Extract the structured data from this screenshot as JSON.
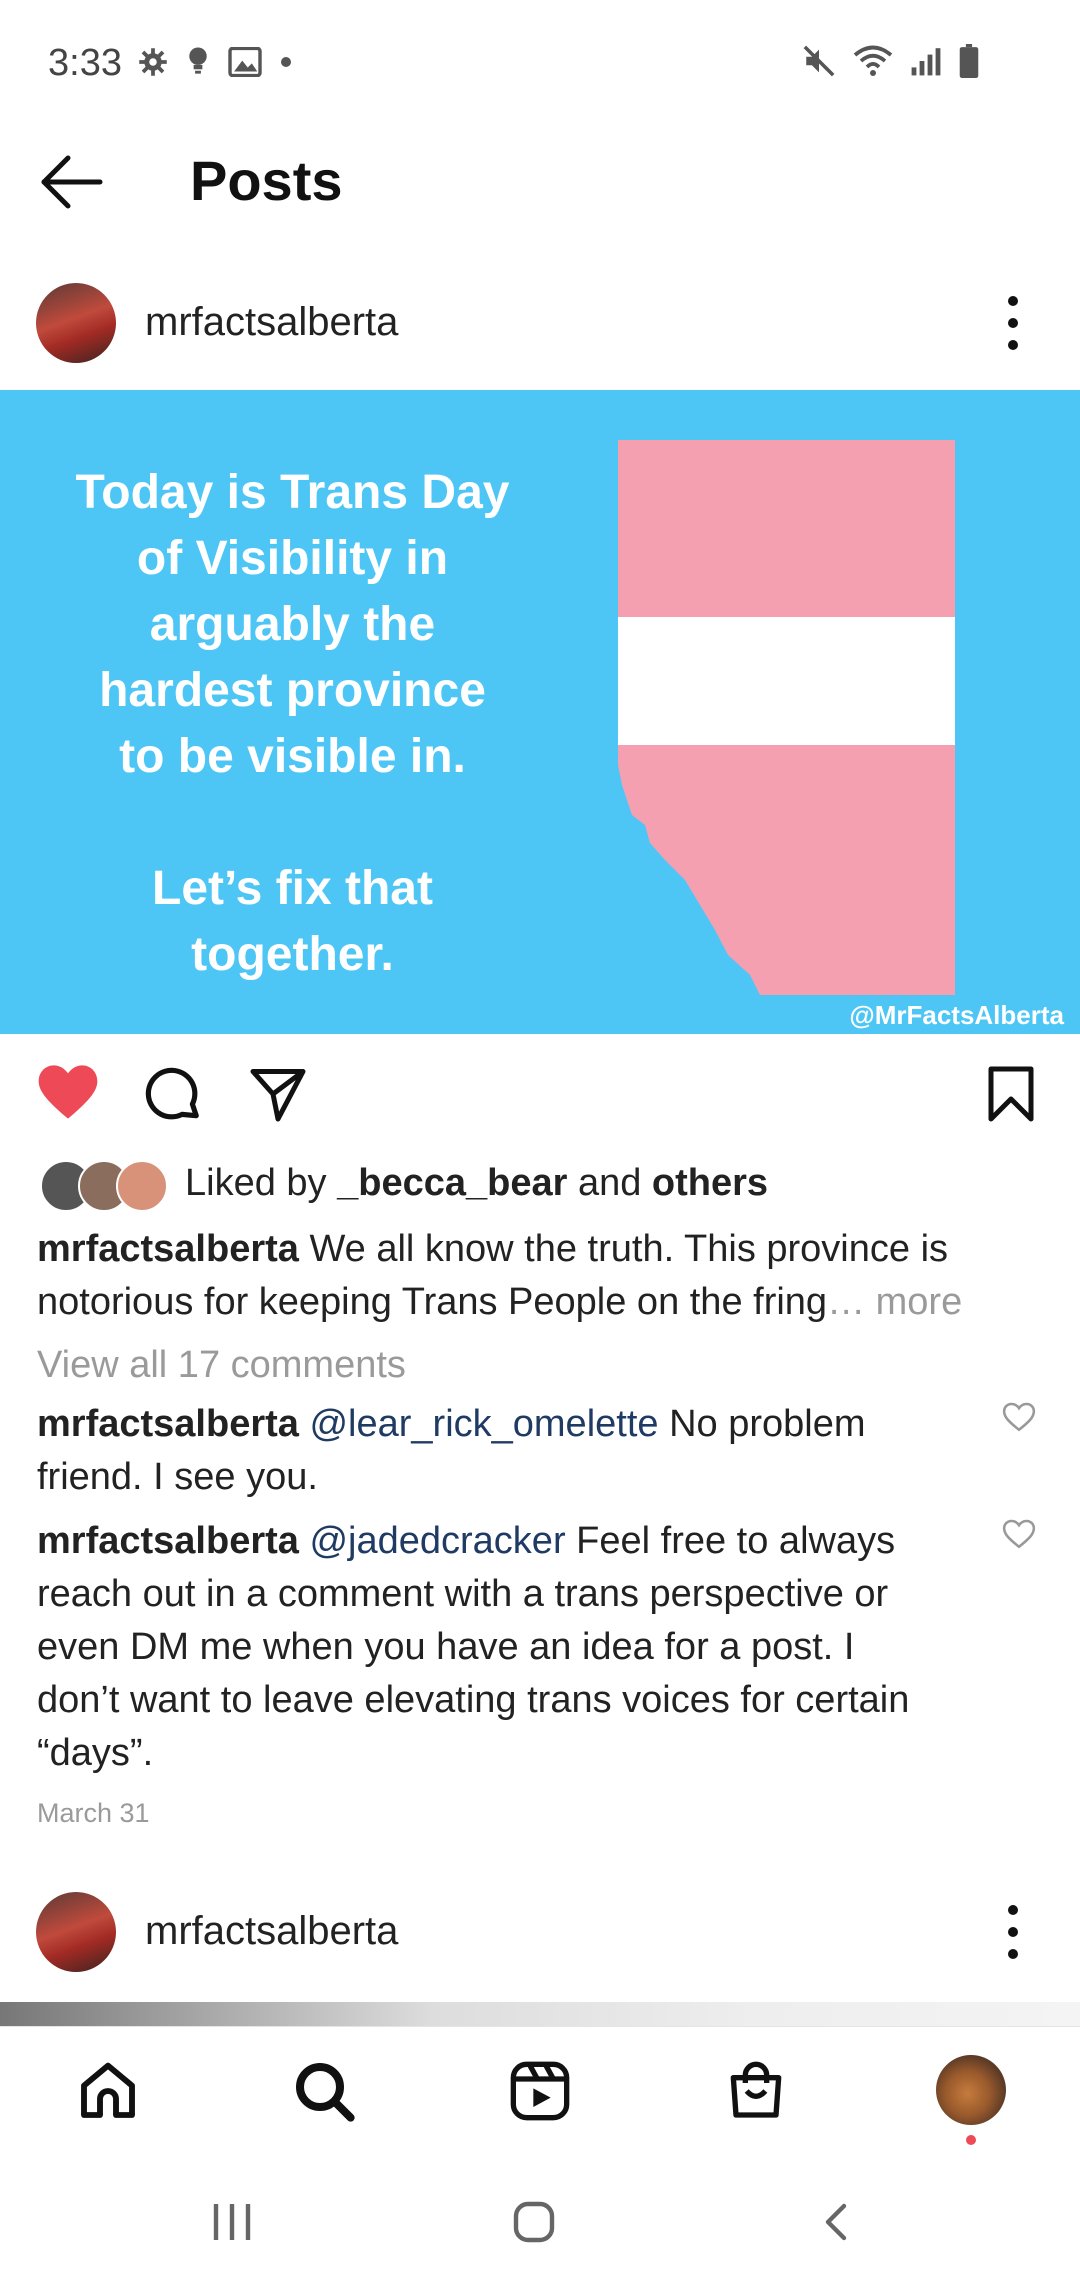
{
  "status_bar": {
    "time": "3:33"
  },
  "header": {
    "title": "Posts"
  },
  "post": {
    "username": "mrfactsalberta",
    "image_text": [
      "Today is Trans Day",
      "of Visibility in",
      "arguably the",
      "hardest province",
      "to be visible in.",
      "",
      "Let’s fix that",
      "together."
    ],
    "watermark": "@MrFactsAlberta",
    "colors": {
      "image_bg": "#4dc6f6",
      "flag_pink": "#f4a0b1",
      "flag_white": "#ffffff",
      "like": "#ed4956"
    },
    "likes": {
      "prefix": "Liked by ",
      "user": "_becca_bear",
      "middle": " and ",
      "suffix": "others"
    },
    "caption": {
      "user": "mrfactsalberta",
      "line1": " We all know the truth. This province is",
      "line2": "notorious for keeping Trans People on the fring",
      "more": "… more"
    },
    "view_comments": "View all 17 comments",
    "comments": [
      {
        "user": "mrfactsalberta",
        "mention": "@lear_rick_omelette",
        "lines": [
          " No problem",
          "friend. I see you."
        ]
      },
      {
        "user": "mrfactsalberta",
        "mention": "@jadedcracker",
        "lines": [
          " Feel free to always",
          "reach out in a comment with a trans perspective or",
          "even DM me when you have an idea for a post. I",
          "don’t want to leave elevating trans voices for certain",
          "“days”."
        ]
      }
    ],
    "date": "March 31"
  },
  "next_post": {
    "username": "mrfactsalberta"
  },
  "nav": {
    "items": [
      "home-icon",
      "search-icon",
      "reels-icon",
      "shop-icon",
      "profile-avatar"
    ]
  }
}
